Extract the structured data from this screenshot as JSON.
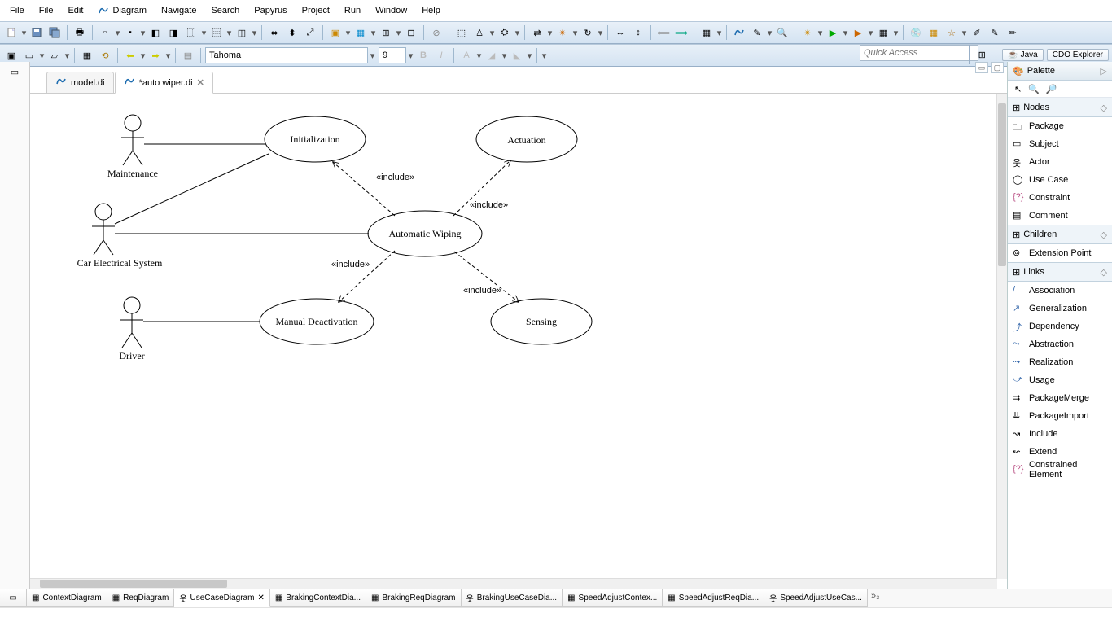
{
  "menu": {
    "items": [
      "File",
      "File",
      "Edit",
      "Diagram",
      "Navigate",
      "Search",
      "Papyrus",
      "Project",
      "Run",
      "Window",
      "Help"
    ]
  },
  "font": {
    "family": "Tahoma",
    "size": "9"
  },
  "quick_access": "Quick Access",
  "perspectives": {
    "java": "Java",
    "cdo": "CDO Explorer"
  },
  "editor_tabs": {
    "model": "model.di",
    "active": "*auto wiper.di"
  },
  "diagram": {
    "actors": [
      {
        "name": "Maintenance"
      },
      {
        "name": "Car Electrical System"
      },
      {
        "name": "Driver"
      }
    ],
    "usecases": {
      "init": "Initialization",
      "auto": "Automatic Wiping",
      "act": "Actuation",
      "deact": "Manual Deactivation",
      "sense": "Sensing"
    },
    "include_label": "«include»"
  },
  "palette": {
    "title": "Palette",
    "groups": {
      "nodes": "Nodes",
      "children": "Children",
      "links": "Links"
    },
    "nodes": [
      "Package",
      "Subject",
      "Actor",
      "Use Case",
      "Constraint",
      "Comment"
    ],
    "children": [
      "Extension Point"
    ],
    "links": [
      "Association",
      "Generalization",
      "Dependency",
      "Abstraction",
      "Realization",
      "Usage",
      "PackageMerge",
      "PackageImport",
      "Include",
      "Extend",
      "Constrained Element"
    ]
  },
  "bottom_tabs": [
    "ContextDiagram",
    "ReqDiagram",
    "UseCaseDiagram",
    "BrakingContextDia...",
    "BrakingReqDiagram",
    "BrakingUseCaseDia...",
    "SpeedAdjustContex...",
    "SpeedAdjustReqDia...",
    "SpeedAdjustUseCas..."
  ]
}
